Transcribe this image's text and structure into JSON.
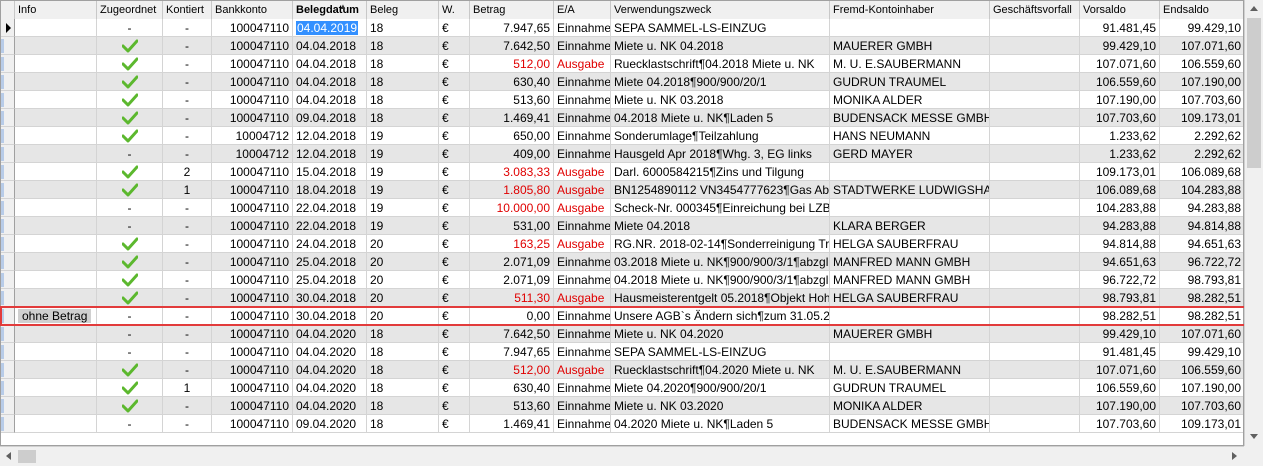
{
  "columns": [
    {
      "label": "Info"
    },
    {
      "label": "Zugeordnet"
    },
    {
      "label": "Kontiert"
    },
    {
      "label": "Bankkonto"
    },
    {
      "label": "Belegdatum"
    },
    {
      "label": "Beleg"
    },
    {
      "label": "W."
    },
    {
      "label": "Betrag"
    },
    {
      "label": "E/A"
    },
    {
      "label": "Verwendungszweck"
    },
    {
      "label": "Fremd-Kontoinhaber"
    },
    {
      "label": "Geschäftsvorfall"
    },
    {
      "label": "Vorsaldo"
    },
    {
      "label": "Endsaldo"
    }
  ],
  "sorted_column": "Belegdatum",
  "colors": {
    "negative": "#e00000",
    "selection": "#3390ff",
    "highlight_border": "#e23b3b",
    "row_alt": "#e6e6e6",
    "check": "#5cb82e"
  },
  "rows": [
    {
      "info": "",
      "zugeordnet": "-",
      "kontiert": "-",
      "bankkonto": "100047110",
      "datum": "04.04.2019",
      "beleg": "18",
      "w": "€",
      "betrag": "7.947,65",
      "ea": "Einnahme",
      "zweck": "SEPA SAMMEL-LS-EINZUG",
      "inhaber": "",
      "vorfall": "",
      "vorsaldo": "91.481,45",
      "endsaldo": "99.429,10",
      "current": true
    },
    {
      "info": "",
      "zugeordnet": "check",
      "kontiert": "-",
      "bankkonto": "100047110",
      "datum": "04.04.2018",
      "beleg": "18",
      "w": "€",
      "betrag": "7.642,50",
      "ea": "Einnahme",
      "zweck": "Miete u. NK 04.2018",
      "inhaber": "MAUERER GMBH",
      "vorfall": "",
      "vorsaldo": "99.429,10",
      "endsaldo": "107.071,60"
    },
    {
      "info": "",
      "zugeordnet": "check",
      "kontiert": "-",
      "bankkonto": "100047110",
      "datum": "04.04.2018",
      "beleg": "18",
      "w": "€",
      "betrag": "512,00",
      "ea": "Ausgabe",
      "zweck": "Ruecklastschrift¶04.2018 Miete u. NK",
      "inhaber": "M. U. E.SAUBERMANN",
      "vorfall": "",
      "vorsaldo": "107.071,60",
      "endsaldo": "106.559,60"
    },
    {
      "info": "",
      "zugeordnet": "check",
      "kontiert": "-",
      "bankkonto": "100047110",
      "datum": "04.04.2018",
      "beleg": "18",
      "w": "€",
      "betrag": "630,40",
      "ea": "Einnahme",
      "zweck": "Miete 04.2018¶900/900/20/1",
      "inhaber": "GUDRUN TRAUMEL",
      "vorfall": "",
      "vorsaldo": "106.559,60",
      "endsaldo": "107.190,00"
    },
    {
      "info": "",
      "zugeordnet": "check",
      "kontiert": "-",
      "bankkonto": "100047110",
      "datum": "04.04.2018",
      "beleg": "18",
      "w": "€",
      "betrag": "513,60",
      "ea": "Einnahme",
      "zweck": "Miete u. NK 03.2018",
      "inhaber": "MONIKA ALDER",
      "vorfall": "",
      "vorsaldo": "107.190,00",
      "endsaldo": "107.703,60"
    },
    {
      "info": "",
      "zugeordnet": "check",
      "kontiert": "-",
      "bankkonto": "100047110",
      "datum": "09.04.2018",
      "beleg": "18",
      "w": "€",
      "betrag": "1.469,41",
      "ea": "Einnahme",
      "zweck": "04.2018 Miete u. NK¶Laden 5",
      "inhaber": "BUDENSACK MESSE GMBH",
      "vorfall": "",
      "vorsaldo": "107.703,60",
      "endsaldo": "109.173,01"
    },
    {
      "info": "",
      "zugeordnet": "check",
      "kontiert": "-",
      "bankkonto": "10004712",
      "datum": "12.04.2018",
      "beleg": "19",
      "w": "€",
      "betrag": "650,00",
      "ea": "Einnahme",
      "zweck": "Sonderumlage¶Teilzahlung",
      "inhaber": "HANS NEUMANN",
      "vorfall": "",
      "vorsaldo": "1.233,62",
      "endsaldo": "2.292,62"
    },
    {
      "info": "",
      "zugeordnet": "-",
      "kontiert": "-",
      "bankkonto": "10004712",
      "datum": "12.04.2018",
      "beleg": "19",
      "w": "€",
      "betrag": "409,00",
      "ea": "Einnahme",
      "zweck": "Hausgeld Apr 2018¶Whg. 3, EG links",
      "inhaber": "GERD MAYER",
      "vorfall": "",
      "vorsaldo": "1.233,62",
      "endsaldo": "2.292,62"
    },
    {
      "info": "",
      "zugeordnet": "check",
      "kontiert": "2",
      "bankkonto": "100047110",
      "datum": "15.04.2018",
      "beleg": "19",
      "w": "€",
      "betrag": "3.083,33",
      "ea": "Ausgabe",
      "zweck": "Darl. 6000584215¶Zins und Tilgung",
      "inhaber": "",
      "vorfall": "",
      "vorsaldo": "109.173,01",
      "endsaldo": "106.089,68"
    },
    {
      "info": "",
      "zugeordnet": "check",
      "kontiert": "1",
      "bankkonto": "100047110",
      "datum": "18.04.2018",
      "beleg": "19",
      "w": "€",
      "betrag": "1.805,80",
      "ea": "Ausgabe",
      "zweck": "BN1254890112 VN3454777623¶Gas Abschlag",
      "inhaber": "STADTWERKE LUDWIGSHAFEN",
      "vorfall": "",
      "vorsaldo": "106.089,68",
      "endsaldo": "104.283,88"
    },
    {
      "info": "",
      "zugeordnet": "-",
      "kontiert": "-",
      "bankkonto": "100047110",
      "datum": "22.04.2018",
      "beleg": "19",
      "w": "€",
      "betrag": "10.000,00",
      "ea": "Ausgabe",
      "zweck": "Scheck-Nr. 000345¶Einreichung bei LZB",
      "inhaber": "",
      "vorfall": "",
      "vorsaldo": "104.283,88",
      "endsaldo": "94.283,88"
    },
    {
      "info": "",
      "zugeordnet": "-",
      "kontiert": "-",
      "bankkonto": "100047110",
      "datum": "22.04.2018",
      "beleg": "19",
      "w": "€",
      "betrag": "531,00",
      "ea": "Einnahme",
      "zweck": "Miete 04.2018",
      "inhaber": "KLARA BERGER",
      "vorfall": "",
      "vorsaldo": "94.283,88",
      "endsaldo": "94.814,88"
    },
    {
      "info": "",
      "zugeordnet": "check",
      "kontiert": "-",
      "bankkonto": "100047110",
      "datum": "24.04.2018",
      "beleg": "20",
      "w": "€",
      "betrag": "163,25",
      "ea": "Ausgabe",
      "zweck": "RG.NR. 2018-02-14¶Sonderreinigung Treppenhaus",
      "inhaber": "HELGA SAUBERFRAU",
      "vorfall": "",
      "vorsaldo": "94.814,88",
      "endsaldo": "94.651,63"
    },
    {
      "info": "",
      "zugeordnet": "check",
      "kontiert": "-",
      "bankkonto": "100047110",
      "datum": "25.04.2018",
      "beleg": "20",
      "w": "€",
      "betrag": "2.071,09",
      "ea": "Einnahme",
      "zweck": "03.2018 Miete u. NK¶900/900/3/1¶abzgl. 20",
      "inhaber": "MANFRED MANN GMBH",
      "vorfall": "",
      "vorsaldo": "94.651,63",
      "endsaldo": "96.722,72"
    },
    {
      "info": "",
      "zugeordnet": "check",
      "kontiert": "-",
      "bankkonto": "100047110",
      "datum": "25.04.2018",
      "beleg": "20",
      "w": "€",
      "betrag": "2.071,09",
      "ea": "Einnahme",
      "zweck": "04.2018 Miete u. NK¶900/900/3/1¶abzgl. 20",
      "inhaber": "MANFRED MANN GMBH",
      "vorfall": "",
      "vorsaldo": "96.722,72",
      "endsaldo": "98.793,81"
    },
    {
      "info": "",
      "zugeordnet": "check",
      "kontiert": "-",
      "bankkonto": "100047110",
      "datum": "30.04.2018",
      "beleg": "20",
      "w": "€",
      "betrag": "511,30",
      "ea": "Ausgabe",
      "zweck": "Hausmeisterentgelt 05.2018¶Objekt Hoher Weg",
      "inhaber": "HELGA SAUBERFRAU",
      "vorfall": "",
      "vorsaldo": "98.793,81",
      "endsaldo": "98.282,51"
    },
    {
      "info": "ohne Betrag",
      "zugeordnet": "-",
      "kontiert": "-",
      "bankkonto": "100047110",
      "datum": "30.04.2018",
      "beleg": "20",
      "w": "€",
      "betrag": "0,00",
      "ea": "Einnahme",
      "zweck": "Unsere AGB`s Ändern sich¶zum 31.05.2020",
      "inhaber": "",
      "vorfall": "",
      "vorsaldo": "98.282,51",
      "endsaldo": "98.282,51",
      "highlighted": true
    },
    {
      "info": "",
      "zugeordnet": "-",
      "kontiert": "-",
      "bankkonto": "100047110",
      "datum": "04.04.2020",
      "beleg": "18",
      "w": "€",
      "betrag": "7.642,50",
      "ea": "Einnahme",
      "zweck": "Miete u. NK 04.2020",
      "inhaber": "MAUERER GMBH",
      "vorfall": "",
      "vorsaldo": "99.429,10",
      "endsaldo": "107.071,60"
    },
    {
      "info": "",
      "zugeordnet": "-",
      "kontiert": "-",
      "bankkonto": "100047110",
      "datum": "04.04.2020",
      "beleg": "18",
      "w": "€",
      "betrag": "7.947,65",
      "ea": "Einnahme",
      "zweck": "SEPA SAMMEL-LS-EINZUG",
      "inhaber": "",
      "vorfall": "",
      "vorsaldo": "91.481,45",
      "endsaldo": "99.429,10"
    },
    {
      "info": "",
      "zugeordnet": "check",
      "kontiert": "-",
      "bankkonto": "100047110",
      "datum": "04.04.2020",
      "beleg": "18",
      "w": "€",
      "betrag": "512,00",
      "ea": "Ausgabe",
      "zweck": "Ruecklastschrift¶04.2020 Miete u. NK",
      "inhaber": "M. U. E.SAUBERMANN",
      "vorfall": "",
      "vorsaldo": "107.071,60",
      "endsaldo": "106.559,60"
    },
    {
      "info": "",
      "zugeordnet": "check",
      "kontiert": "1",
      "bankkonto": "100047110",
      "datum": "04.04.2020",
      "beleg": "18",
      "w": "€",
      "betrag": "630,40",
      "ea": "Einnahme",
      "zweck": "Miete 04.2020¶900/900/20/1",
      "inhaber": "GUDRUN TRAUMEL",
      "vorfall": "",
      "vorsaldo": "106.559,60",
      "endsaldo": "107.190,00"
    },
    {
      "info": "",
      "zugeordnet": "check",
      "kontiert": "-",
      "bankkonto": "100047110",
      "datum": "04.04.2020",
      "beleg": "18",
      "w": "€",
      "betrag": "513,60",
      "ea": "Einnahme",
      "zweck": "Miete u. NK 03.2020",
      "inhaber": "MONIKA ALDER",
      "vorfall": "",
      "vorsaldo": "107.190,00",
      "endsaldo": "107.703,60"
    },
    {
      "info": "",
      "zugeordnet": "-",
      "kontiert": "-",
      "bankkonto": "100047110",
      "datum": "09.04.2020",
      "beleg": "18",
      "w": "€",
      "betrag": "1.469,41",
      "ea": "Einnahme",
      "zweck": "04.2020 Miete u. NK¶Laden 5",
      "inhaber": "BUDENSACK MESSE GMBH",
      "vorfall": "",
      "vorsaldo": "107.703,60",
      "endsaldo": "109.173,01"
    }
  ],
  "icons": {
    "row_indicator": "current-row-triangle-icon",
    "assigned": "check-icon",
    "scroll_up": "chevron-up-icon",
    "scroll_down": "chevron-down-icon",
    "scroll_left": "chevron-left-icon",
    "scroll_right": "chevron-right-icon"
  }
}
